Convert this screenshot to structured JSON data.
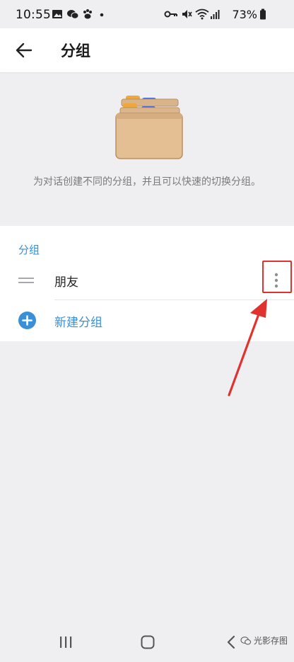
{
  "status_bar": {
    "time": "10:55",
    "battery": "73%"
  },
  "app_bar": {
    "title": "分组"
  },
  "hero": {
    "description": "为对话创建不同的分组，并且可以快速的切换分组。"
  },
  "folders": {
    "section_title": "分组",
    "items": [
      {
        "label": "朋友"
      }
    ],
    "new_folder_label": "新建分组"
  },
  "watermark": {
    "text": "光影存图"
  },
  "colors": {
    "accent": "#3a8fd6",
    "annotation": "#e0322e"
  }
}
